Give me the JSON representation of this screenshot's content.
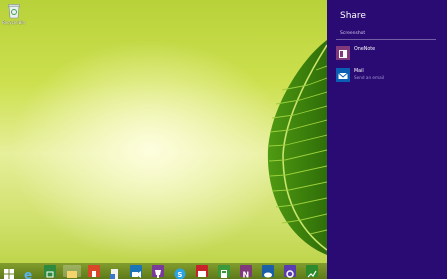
{
  "desktop": {
    "recycle_bin_label": "Recycle Bin"
  },
  "share_pane": {
    "title": "Share",
    "subtitle": "Screenshot",
    "apps": [
      {
        "name": "OneNote",
        "description": "",
        "icon": "onenote-icon",
        "color": "#80397b"
      },
      {
        "name": "Mail",
        "description": "Send an email",
        "icon": "mail-icon",
        "color": "#0a5fb4"
      }
    ],
    "background_color": "#2a0a73"
  },
  "taskbar": {
    "icons": [
      "start-icon",
      "internet-explorer-icon",
      "store-icon",
      "file-explorer-icon",
      "office-icon",
      "documents-icon",
      "video-icon",
      "trophy-icon",
      "skype-icon",
      "news-icon",
      "calculator-icon",
      "onenote-icon",
      "onedrive-icon",
      "settings-icon",
      "finance-icon"
    ]
  }
}
